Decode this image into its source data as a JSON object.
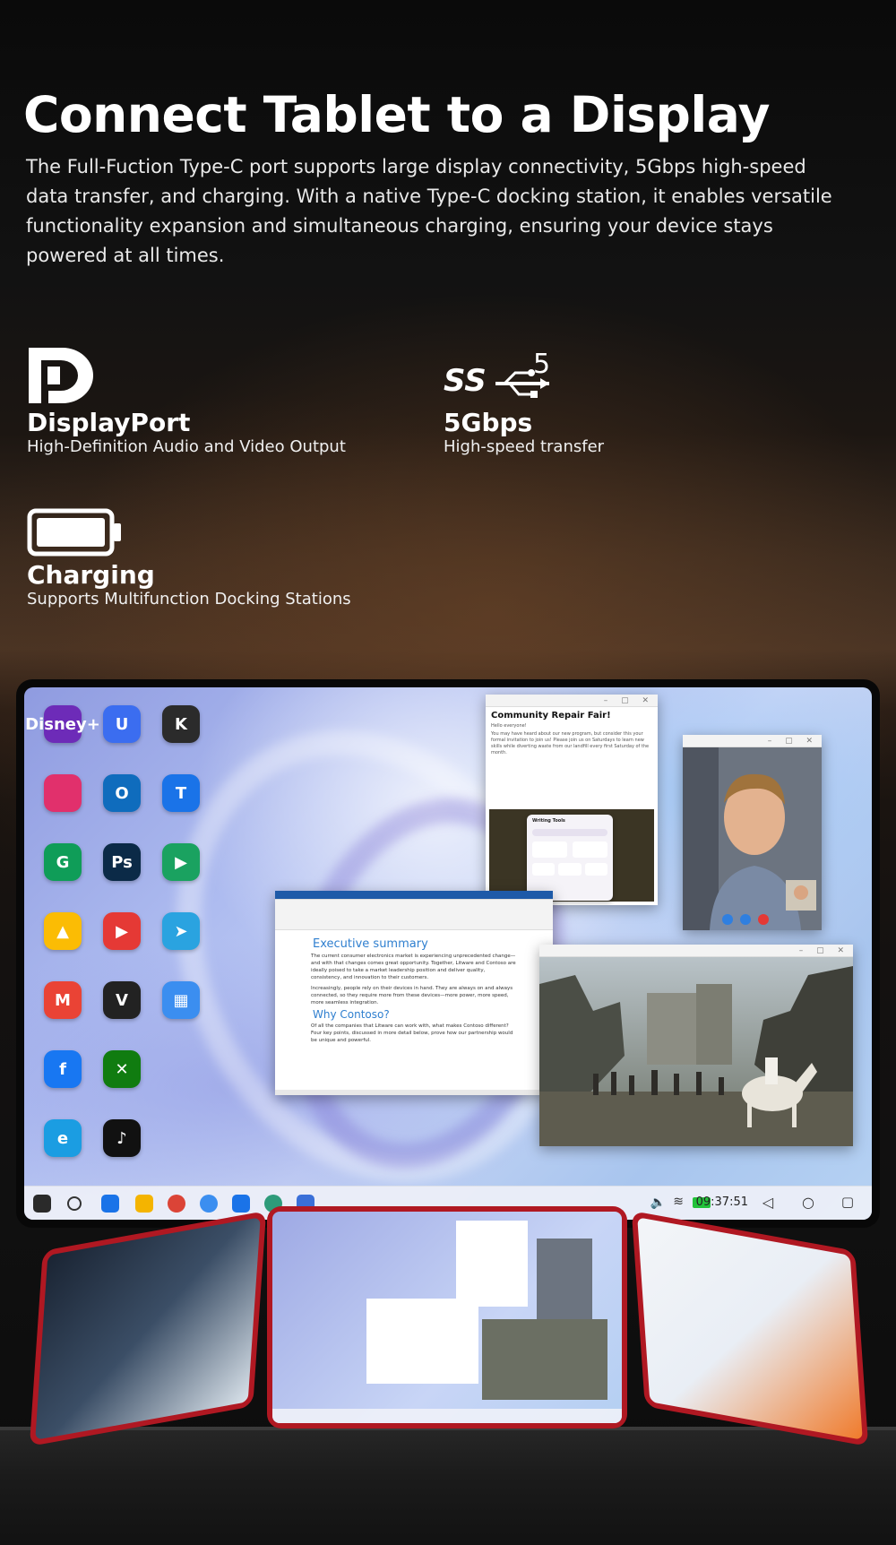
{
  "hero": {
    "title": "Connect Tablet to a Display",
    "description": "The Full-Fuction Type-C port supports large display connectivity, 5Gbps high-speed data transfer, and charging. With a native Type-C docking station, it enables versatile functionality expansion and simultaneous charging, ensuring your device stays powered at all times."
  },
  "features": {
    "displayport": {
      "icon": "displayport-icon",
      "name": "DisplayPort",
      "desc": "High-Definition Audio and Video Output"
    },
    "superspeed": {
      "icon": "usb-superspeed-5-icon",
      "icon_text": "SS",
      "icon_superscript": "5",
      "name": "5Gbps",
      "desc": "High-speed transfer"
    },
    "charging": {
      "icon": "battery-icon",
      "name": "Charging",
      "desc": "Supports Multifunction Docking Stations"
    }
  },
  "screen": {
    "apps": [
      {
        "name": "Disney+",
        "label": "Disney+",
        "color": "#6d2bb8"
      },
      {
        "name": "U",
        "label": "U",
        "color": "#3b6df0"
      },
      {
        "name": "K",
        "label": "K",
        "color": "#2b2b2b"
      },
      {
        "name": "Instagram",
        "label": "",
        "color": "#e1306c"
      },
      {
        "name": "Outlook",
        "label": "O",
        "color": "#0f6cbd"
      },
      {
        "name": "Translate",
        "label": "T",
        "color": "#1a73e8"
      },
      {
        "name": "Classroom",
        "label": "G",
        "color": "#0f9d58"
      },
      {
        "name": "Photoshop",
        "label": "Ps",
        "color": "#0b2a47"
      },
      {
        "name": "Video",
        "label": "▶",
        "color": "#1aa260"
      },
      {
        "name": "Drive",
        "label": "▲",
        "color": "#fbbc04"
      },
      {
        "name": "TV",
        "label": "▶",
        "color": "#e53935"
      },
      {
        "name": "Telegram",
        "label": "➤",
        "color": "#2aa3e0"
      },
      {
        "name": "Gmail",
        "label": "M",
        "color": "#ea4335"
      },
      {
        "name": "V",
        "label": "V",
        "color": "#222222"
      },
      {
        "name": "Store",
        "label": "▦",
        "color": "#3b8ef0"
      },
      {
        "name": "Facebook",
        "label": "f",
        "color": "#1877f2"
      },
      {
        "name": "Xbox",
        "label": "✕",
        "color": "#107c10"
      },
      {
        "name": "Edge",
        "label": "e",
        "color": "#1b9de2"
      },
      {
        "name": "TikTok",
        "label": "♪",
        "color": "#111111"
      }
    ],
    "mail": {
      "title": "Community Repair Fair!",
      "greeting": "Hello everyone!",
      "body": "You may have heard about our new program, but consider this your formal invitation to join us! Please join us on Saturdays to learn new skills while diverting waste from our landfill every first Saturday of the month.",
      "tool": "Writing Tools"
    },
    "doc": {
      "heading": "Executive summary",
      "para1": "The current consumer electronics market is experiencing unprecedented change—and with that changes comes great opportunity. Together, Litware and Contoso are ideally poised to take a market leadership position and deliver quality, consistency, and innovation to their customers.",
      "para2": "Increasingly, people rely on their devices in hand. They are always on and always connected, so they require more from these devices—more power, more speed, more seamless integration.",
      "heading2": "Why Contoso?",
      "para3": "Of all the companies that Litware can work with, what makes Contoso different? Four key points, discussed in more detail below, prove how our partnership would be unique and powerful."
    },
    "taskbar": {
      "time": "09:37:51",
      "battery_color": "#22c23a"
    }
  }
}
